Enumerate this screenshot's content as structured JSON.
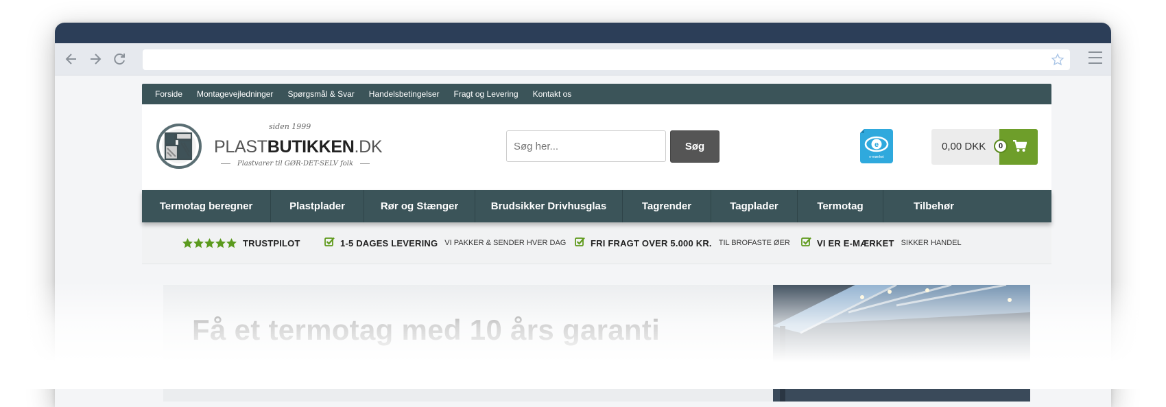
{
  "browser": {
    "url": "",
    "icons": [
      "back-arrow-icon",
      "forward-arrow-icon",
      "reload-icon",
      "bookmark-star-icon",
      "hamburger-menu-icon"
    ]
  },
  "topbar": {
    "links": [
      "Forside",
      "Montagevejledninger",
      "Spørgsmål & Svar",
      "Handelsbetingelser",
      "Fragt og Levering",
      "Kontakt os"
    ]
  },
  "logo": {
    "since": "siden 1999",
    "name_light": "PLAST",
    "name_bold": "BUTIKKEN",
    "name_tld": ".DK",
    "tagline": "Plastvarer til GØR-DET-SELV folk"
  },
  "search": {
    "placeholder": "Søg her...",
    "button": "Søg"
  },
  "emaerket": {
    "label": "e-mærket"
  },
  "cart": {
    "total": "0,00 DKK",
    "count": "0"
  },
  "mainnav": [
    "Termotag beregner",
    "Plastplader",
    "Rør og Stænger",
    "Brudsikker Drivhusglas",
    "Tagrender",
    "Tagplader",
    "Termotag",
    "Tilbehør"
  ],
  "usp": {
    "trustpilot": "TRUSTPILOT",
    "items": [
      {
        "strong": "1-5 DAGES LEVERING",
        "sub": "VI PAKKER & SENDER HVER DAG"
      },
      {
        "strong": "FRI FRAGT OVER 5.000 KR.",
        "sub": "TIL BROFASTE ØER"
      },
      {
        "strong": "VI ER E-MÆRKET",
        "sub": "SIKKER HANDEL"
      }
    ]
  },
  "hero": {
    "headline": "Få et termotag med 10 års garanti"
  },
  "colors": {
    "titlebar": "#2c3e58",
    "nav": "#3b5459",
    "cart_green": "#6e9e2a",
    "check_green": "#5f9a1c",
    "star_green": "#5b9a1e"
  }
}
